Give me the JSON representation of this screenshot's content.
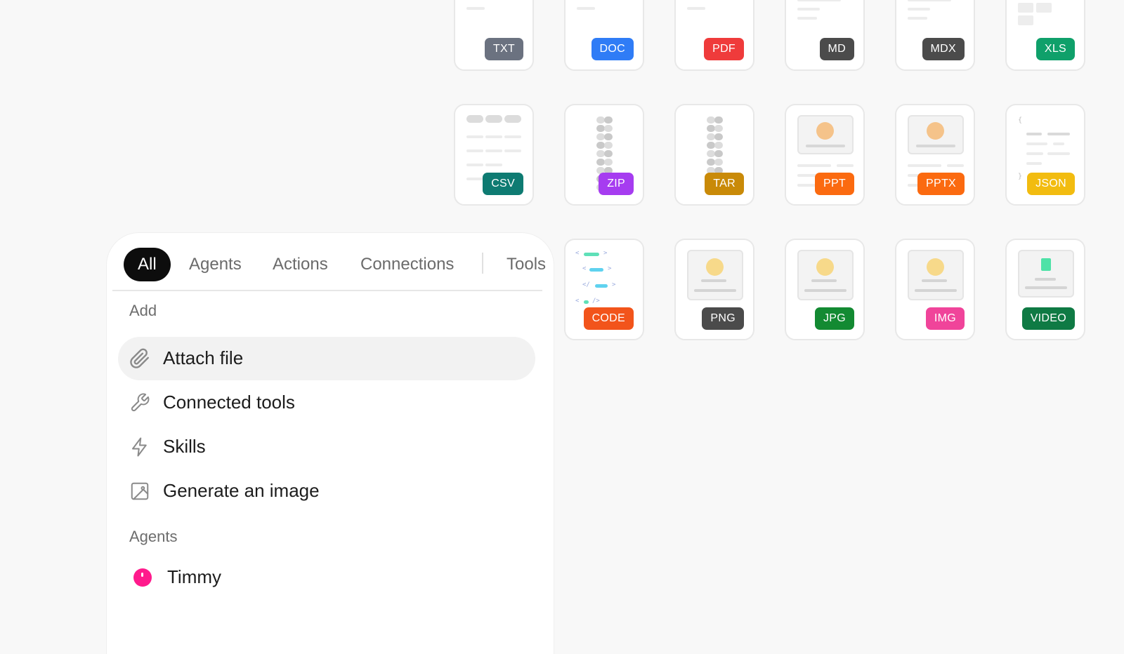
{
  "file_types": {
    "txt": {
      "label": "TXT",
      "color": "#6b7280"
    },
    "doc": {
      "label": "DOC",
      "color": "#2f7cf6"
    },
    "pdf": {
      "label": "PDF",
      "color": "#ef3b3b"
    },
    "md": {
      "label": "MD",
      "color": "#4b4b4b"
    },
    "mdx": {
      "label": "MDX",
      "color": "#4b4b4b"
    },
    "xls": {
      "label": "XLS",
      "color": "#0fa06a"
    },
    "csv": {
      "label": "CSV",
      "color": "#0e7b72"
    },
    "zip": {
      "label": "ZIP",
      "color": "#a63cf0"
    },
    "tar": {
      "label": "TAR",
      "color": "#c98a08"
    },
    "ppt": {
      "label": "PPT",
      "color": "#fb6a10"
    },
    "pptx": {
      "label": "PPTX",
      "color": "#fb6a10"
    },
    "json": {
      "label": "JSON",
      "color": "#f2bc10"
    },
    "code": {
      "label": "CODE",
      "color": "#f2541b"
    },
    "png": {
      "label": "PNG",
      "color": "#4b4b4b"
    },
    "jpg": {
      "label": "JPG",
      "color": "#138a32"
    },
    "img": {
      "label": "IMG",
      "color": "#f0449a"
    },
    "video": {
      "label": "VIDEO",
      "color": "#0f7a44"
    }
  },
  "menu": {
    "tabs": [
      {
        "label": "All",
        "active": true
      },
      {
        "label": "Agents"
      },
      {
        "label": "Actions"
      },
      {
        "label": "Connections"
      },
      {
        "label": "Tools"
      }
    ],
    "sections": {
      "add": {
        "title": "Add",
        "items": [
          {
            "label": "Attach file",
            "icon": "paperclip-icon",
            "highlighted": true
          },
          {
            "label": "Connected tools",
            "icon": "wrench-icon"
          },
          {
            "label": "Skills",
            "icon": "lightning-icon"
          },
          {
            "label": "Generate an image",
            "icon": "image-icon"
          }
        ]
      },
      "agents": {
        "title": "Agents",
        "items": [
          {
            "label": "Timmy",
            "icon": "avatar-icon",
            "avatar_color": "#ff1a8c"
          }
        ]
      }
    }
  },
  "accent_colors": {
    "active_tab_bg": "#0d0d0d",
    "highlight_bg": "#f2f2f2"
  }
}
